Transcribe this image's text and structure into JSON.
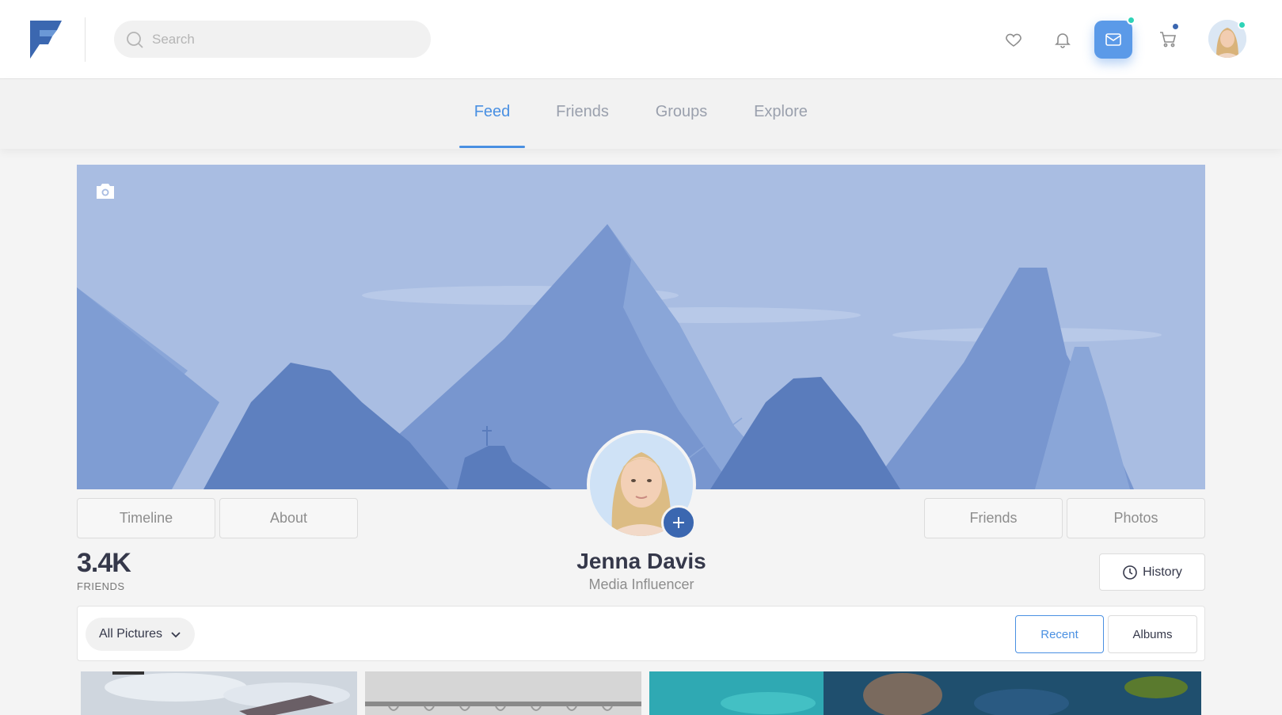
{
  "header": {
    "search_placeholder": "Search",
    "colors": {
      "accent": "#4a90e2",
      "mail_active": "#5b9ae8",
      "online_dot": "#2ed3b7",
      "cart_dot": "#3b67b0"
    }
  },
  "nav": {
    "tabs": [
      {
        "label": "Feed",
        "active": true
      },
      {
        "label": "Friends",
        "active": false
      },
      {
        "label": "Groups",
        "active": false
      },
      {
        "label": "Explore",
        "active": false
      }
    ]
  },
  "profile": {
    "tabs_left": [
      "Timeline",
      "About"
    ],
    "tabs_right": [
      "Friends",
      "Photos"
    ],
    "name": "Jenna Davis",
    "role": "Media Influencer",
    "friends_count": "3.4K",
    "friends_label": "FRIENDS",
    "history_label": "History"
  },
  "gallery": {
    "filter_label": "All Pictures",
    "recent_label": "Recent",
    "albums_label": "Albums"
  }
}
